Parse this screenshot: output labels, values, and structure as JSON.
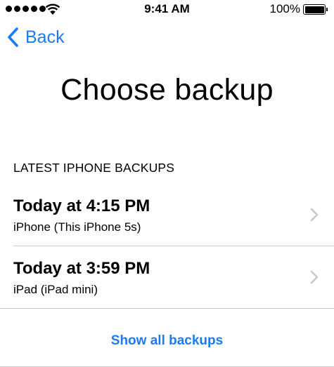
{
  "status_bar": {
    "time": "9:41 AM",
    "battery_percent": "100%",
    "signal_bars": 5,
    "battery_level": 1.0
  },
  "nav": {
    "back_label": "Back"
  },
  "page": {
    "title": "Choose backup"
  },
  "section": {
    "header": "LATEST IPHONE BACKUPS"
  },
  "backups": [
    {
      "title": "Today at 4:15 PM",
      "subtitle": "iPhone (This iPhone 5s)"
    },
    {
      "title": "Today at 3:59 PM",
      "subtitle": "iPad (iPad mini)"
    }
  ],
  "footer": {
    "show_all_label": "Show all backups"
  },
  "colors": {
    "accent": "#1a7cf5",
    "chevron": "#c7c7cc",
    "separator": "#c8c7cc"
  }
}
